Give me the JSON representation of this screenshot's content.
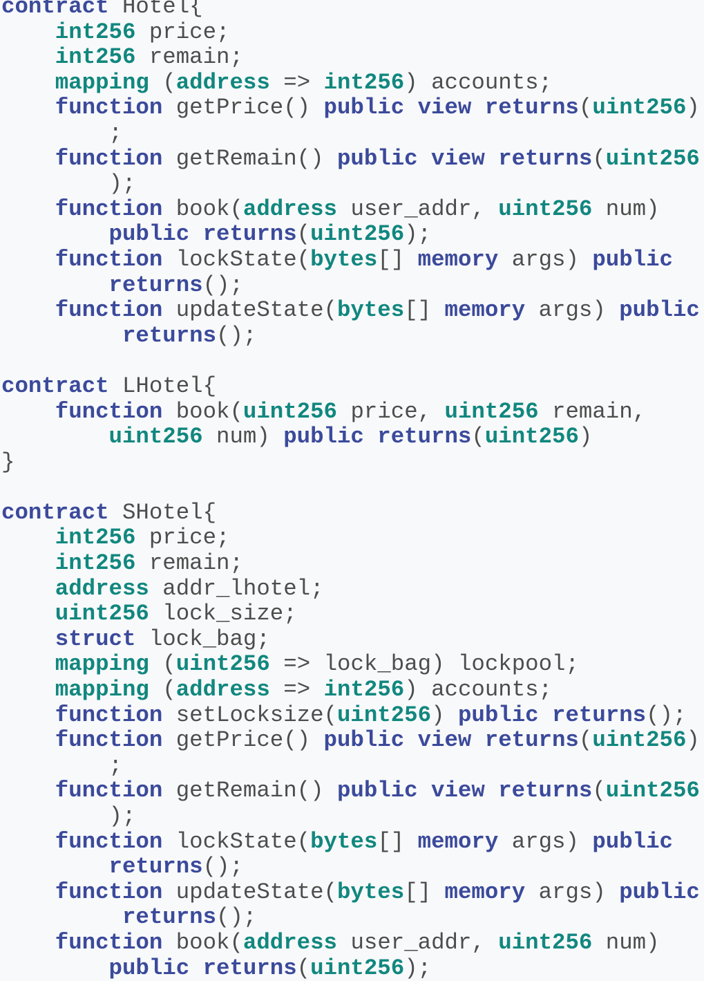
{
  "colors": {
    "background": "#f8f9fa",
    "plain_text": "#4d4d4d",
    "keyword": "#3b4a9b",
    "type": "#11877f"
  },
  "code_lines": [
    [
      [
        "kw",
        "contract"
      ],
      [
        "id",
        " Hotel{"
      ]
    ],
    [
      [
        "id",
        "    "
      ],
      [
        "ty",
        "int256"
      ],
      [
        "id",
        " price;"
      ]
    ],
    [
      [
        "id",
        "    "
      ],
      [
        "ty",
        "int256"
      ],
      [
        "id",
        " remain;"
      ]
    ],
    [
      [
        "id",
        "    "
      ],
      [
        "ty",
        "mapping"
      ],
      [
        "id",
        " ("
      ],
      [
        "ty",
        "address"
      ],
      [
        "id",
        " => "
      ],
      [
        "ty",
        "int256"
      ],
      [
        "id",
        ") accounts;"
      ]
    ],
    [
      [
        "id",
        "    "
      ],
      [
        "kw",
        "function"
      ],
      [
        "id",
        " getPrice() "
      ],
      [
        "kw",
        "public view returns"
      ],
      [
        "id",
        "("
      ],
      [
        "ty",
        "uint256"
      ],
      [
        "id",
        ")"
      ]
    ],
    [
      [
        "id",
        "        ;"
      ]
    ],
    [
      [
        "id",
        "    "
      ],
      [
        "kw",
        "function"
      ],
      [
        "id",
        " getRemain() "
      ],
      [
        "kw",
        "public view returns"
      ],
      [
        "id",
        "("
      ],
      [
        "ty",
        "uint256"
      ]
    ],
    [
      [
        "id",
        "        );"
      ]
    ],
    [
      [
        "id",
        "    "
      ],
      [
        "kw",
        "function"
      ],
      [
        "id",
        " book("
      ],
      [
        "ty",
        "address"
      ],
      [
        "id",
        " user_addr, "
      ],
      [
        "ty",
        "uint256"
      ],
      [
        "id",
        " num)"
      ]
    ],
    [
      [
        "id",
        "        "
      ],
      [
        "kw",
        "public returns"
      ],
      [
        "id",
        "("
      ],
      [
        "ty",
        "uint256"
      ],
      [
        "id",
        ");"
      ]
    ],
    [
      [
        "id",
        "    "
      ],
      [
        "kw",
        "function"
      ],
      [
        "id",
        " lockState("
      ],
      [
        "ty",
        "bytes"
      ],
      [
        "id",
        "[] "
      ],
      [
        "kw",
        "memory"
      ],
      [
        "id",
        " args) "
      ],
      [
        "kw",
        "public"
      ]
    ],
    [
      [
        "id",
        "        "
      ],
      [
        "kw",
        "returns"
      ],
      [
        "id",
        "();"
      ]
    ],
    [
      [
        "id",
        "    "
      ],
      [
        "kw",
        "function"
      ],
      [
        "id",
        " updateState("
      ],
      [
        "ty",
        "bytes"
      ],
      [
        "id",
        "[] "
      ],
      [
        "kw",
        "memory"
      ],
      [
        "id",
        " args) "
      ],
      [
        "kw",
        "public"
      ]
    ],
    [
      [
        "id",
        "         "
      ],
      [
        "kw",
        "returns"
      ],
      [
        "id",
        "();"
      ]
    ],
    [],
    [
      [
        "kw",
        "contract"
      ],
      [
        "id",
        " LHotel{"
      ]
    ],
    [
      [
        "id",
        "    "
      ],
      [
        "kw",
        "function"
      ],
      [
        "id",
        " book("
      ],
      [
        "ty",
        "uint256"
      ],
      [
        "id",
        " price, "
      ],
      [
        "ty",
        "uint256"
      ],
      [
        "id",
        " remain,"
      ]
    ],
    [
      [
        "id",
        "        "
      ],
      [
        "ty",
        "uint256"
      ],
      [
        "id",
        " num) "
      ],
      [
        "kw",
        "public returns"
      ],
      [
        "id",
        "("
      ],
      [
        "ty",
        "uint256"
      ],
      [
        "id",
        ")"
      ]
    ],
    [
      [
        "id",
        "}"
      ]
    ],
    [],
    [
      [
        "kw",
        "contract"
      ],
      [
        "id",
        " SHotel{"
      ]
    ],
    [
      [
        "id",
        "    "
      ],
      [
        "ty",
        "int256"
      ],
      [
        "id",
        " price;"
      ]
    ],
    [
      [
        "id",
        "    "
      ],
      [
        "ty",
        "int256"
      ],
      [
        "id",
        " remain;"
      ]
    ],
    [
      [
        "id",
        "    "
      ],
      [
        "ty",
        "address"
      ],
      [
        "id",
        " addr_lhotel;"
      ]
    ],
    [
      [
        "id",
        "    "
      ],
      [
        "ty",
        "uint256"
      ],
      [
        "id",
        " lock_size;"
      ]
    ],
    [
      [
        "id",
        "    "
      ],
      [
        "kw",
        "struct"
      ],
      [
        "id",
        " lock_bag;"
      ]
    ],
    [
      [
        "id",
        "    "
      ],
      [
        "ty",
        "mapping"
      ],
      [
        "id",
        " ("
      ],
      [
        "ty",
        "uint256"
      ],
      [
        "id",
        " => lock_bag) lockpool;"
      ]
    ],
    [
      [
        "id",
        "    "
      ],
      [
        "ty",
        "mapping"
      ],
      [
        "id",
        " ("
      ],
      [
        "ty",
        "address"
      ],
      [
        "id",
        " => "
      ],
      [
        "ty",
        "int256"
      ],
      [
        "id",
        ") accounts;"
      ]
    ],
    [
      [
        "id",
        "    "
      ],
      [
        "kw",
        "function"
      ],
      [
        "id",
        " setLocksize("
      ],
      [
        "ty",
        "uint256"
      ],
      [
        "id",
        ") "
      ],
      [
        "kw",
        "public returns"
      ],
      [
        "id",
        "();"
      ]
    ],
    [
      [
        "id",
        "    "
      ],
      [
        "kw",
        "function"
      ],
      [
        "id",
        " getPrice() "
      ],
      [
        "kw",
        "public view returns"
      ],
      [
        "id",
        "("
      ],
      [
        "ty",
        "uint256"
      ],
      [
        "id",
        ")"
      ]
    ],
    [
      [
        "id",
        "        ;"
      ]
    ],
    [
      [
        "id",
        "    "
      ],
      [
        "kw",
        "function"
      ],
      [
        "id",
        " getRemain() "
      ],
      [
        "kw",
        "public view returns"
      ],
      [
        "id",
        "("
      ],
      [
        "ty",
        "uint256"
      ]
    ],
    [
      [
        "id",
        "        );"
      ]
    ],
    [
      [
        "id",
        "    "
      ],
      [
        "kw",
        "function"
      ],
      [
        "id",
        " lockState("
      ],
      [
        "ty",
        "bytes"
      ],
      [
        "id",
        "[] "
      ],
      [
        "kw",
        "memory"
      ],
      [
        "id",
        " args) "
      ],
      [
        "kw",
        "public"
      ]
    ],
    [
      [
        "id",
        "        "
      ],
      [
        "kw",
        "returns"
      ],
      [
        "id",
        "();"
      ]
    ],
    [
      [
        "id",
        "    "
      ],
      [
        "kw",
        "function"
      ],
      [
        "id",
        " updateState("
      ],
      [
        "ty",
        "bytes"
      ],
      [
        "id",
        "[] "
      ],
      [
        "kw",
        "memory"
      ],
      [
        "id",
        " args) "
      ],
      [
        "kw",
        "public"
      ]
    ],
    [
      [
        "id",
        "         "
      ],
      [
        "kw",
        "returns"
      ],
      [
        "id",
        "();"
      ]
    ],
    [
      [
        "id",
        "    "
      ],
      [
        "kw",
        "function"
      ],
      [
        "id",
        " book("
      ],
      [
        "ty",
        "address"
      ],
      [
        "id",
        " user_addr, "
      ],
      [
        "ty",
        "uint256"
      ],
      [
        "id",
        " num)"
      ]
    ],
    [
      [
        "id",
        "        "
      ],
      [
        "kw",
        "public returns"
      ],
      [
        "id",
        "("
      ],
      [
        "ty",
        "uint256"
      ],
      [
        "id",
        ");"
      ]
    ]
  ]
}
